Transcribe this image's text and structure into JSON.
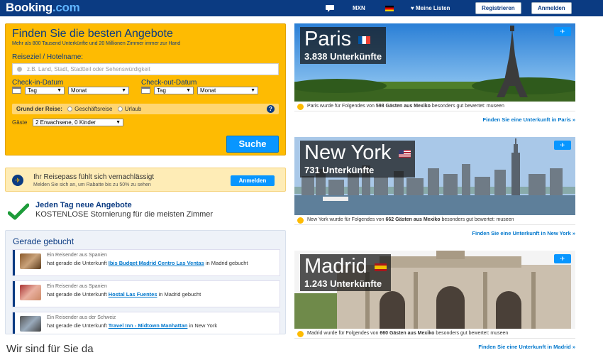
{
  "header": {
    "logo_main": "Booking",
    "logo_tld": ".com",
    "currency": "MXN",
    "lists_label": "Meine Listen",
    "register_label": "Registrieren",
    "login_label": "Anmelden"
  },
  "search": {
    "title": "Finden Sie die besten Angebote",
    "subtitle": "Mehr als 800 Tausend Unterkünfte und 20 Millionen Zimmer immer zur Hand",
    "dest_label": "Reiseziel / Hotelname:",
    "dest_placeholder": "z.B. Land, Stadt, Stadtteil oder Sehenswürdigkeit",
    "checkin_label": "Check-in-Datum",
    "checkout_label": "Check-out-Datum",
    "day_value": "Tag",
    "month_value": "Monat",
    "reason_label": "Grund der Reise:",
    "reason_business": "Geschäftsreise",
    "reason_leisure": "Urlaub",
    "guests_label": "Gäste",
    "guests_value": "2 Erwachsene, 0 Kinder",
    "button_label": "Suche"
  },
  "passport": {
    "title": "Ihr Reisepass fühlt sich vernachlässigt",
    "subtitle": "Melden Sie sich an, um Rabatte bis zu 50% zu sehen",
    "button_label": "Anmelden"
  },
  "deals": {
    "title": "Jeden Tag neue Angebote",
    "subtitle": "KOSTENLOSE Stornierung für die meisten Zimmer"
  },
  "booked": {
    "title": "Gerade gebucht",
    "items": [
      {
        "origin": "Ein Reisender aus Spanien",
        "pre": "hat gerade die Unterkunft ",
        "hotel": "Ibis Budget Madrid Centro Las Ventas",
        "post": " in Madrid gebucht"
      },
      {
        "origin": "Ein Reisender aus Spanien",
        "pre": "hat gerade die Unterkunft ",
        "hotel": "Hostal Las Fuentes",
        "post": " in Madrid gebucht"
      },
      {
        "origin": "Ein Reisender aus der Schweiz",
        "pre": "hat gerade die Unterkunft ",
        "hotel": "Travel Inn - Midtown Manhattan",
        "post": " in New York"
      }
    ]
  },
  "help_title": "Wir sind für Sie da",
  "destinations": [
    {
      "city": "Paris",
      "count": "3.838 Unterkünfte",
      "info_pre": "Paris wurde für Folgendes von ",
      "info_bold": "598 Gästen aus Mexiko",
      "info_post": " besonders gut bewertet: museen",
      "find": "Finden Sie eine Unterkunft in Paris »"
    },
    {
      "city": "New York",
      "count": "731 Unterkünfte",
      "info_pre": "New York wurde für Folgendes von ",
      "info_bold": "662 Gästen aus Mexiko",
      "info_post": " besonders gut bewertet: museen",
      "find": "Finden Sie eine Unterkunft in New York »"
    },
    {
      "city": "Madrid",
      "count": "1.243 Unterkünfte",
      "info_pre": "Madrid wurde für Folgendes von ",
      "info_bold": "660 Gästen aus Mexiko",
      "info_post": " besonders gut bewertet: museen",
      "find": "Finden Sie eine Unterkunft in Madrid »"
    }
  ],
  "colors": {
    "brand_blue": "#0b3b82",
    "accent_yellow": "#febb02",
    "button_blue": "#0896ff",
    "link_blue": "#0077cc"
  }
}
